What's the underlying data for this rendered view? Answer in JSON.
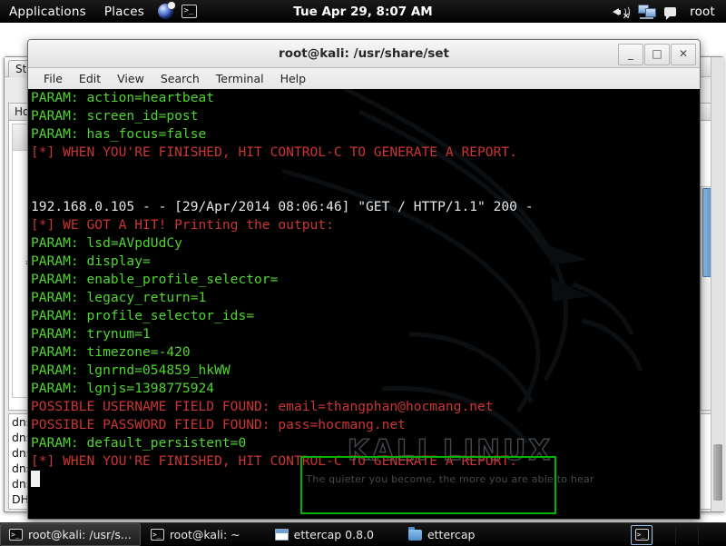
{
  "top_panel": {
    "applications_label": "Applications",
    "places_label": "Places",
    "clock": "Tue Apr 29, 8:07 AM",
    "user_label": "root",
    "launchers": [
      {
        "name": "iceweasel-browser-icon"
      },
      {
        "name": "terminal-icon"
      }
    ],
    "tray": [
      {
        "name": "volume-muted-icon"
      },
      {
        "name": "network-icon"
      },
      {
        "name": "chat-icon"
      }
    ]
  },
  "background_window": {
    "tab_label": "Sta",
    "column_header": "Ho:",
    "star_marker": "*",
    "rows": [
      "dns_",
      "dns_",
      "dns_",
      "dns_",
      "dns_",
      "DHC"
    ]
  },
  "terminal": {
    "title": "root@kali: /usr/share/set",
    "menu": [
      "File",
      "Edit",
      "View",
      "Search",
      "Terminal",
      "Help"
    ],
    "window_buttons": [
      {
        "name": "minimize-button",
        "glyph": "_"
      },
      {
        "name": "maximize-button",
        "glyph": "□"
      },
      {
        "name": "close-button",
        "glyph": "✕"
      }
    ],
    "watermark": {
      "logo": "KALI LINUX",
      "tagline": "The quieter you become, the more you are able to hear"
    },
    "colors": {
      "green": "#4fd430",
      "red": "#cb3434",
      "white": "#e6e6e6",
      "annotation": "#00b200",
      "background": "#000000"
    },
    "lines": [
      {
        "text": "PARAM: action=heartbeat",
        "color": "green"
      },
      {
        "text": "PARAM: screen_id=post",
        "color": "green"
      },
      {
        "text": "PARAM: has_focus=false",
        "color": "green"
      },
      {
        "text": "[*] WHEN YOU'RE FINISHED, HIT CONTROL-C TO GENERATE A REPORT.",
        "color": "red"
      },
      {
        "text": "",
        "color": "blank"
      },
      {
        "text": "",
        "color": "blank"
      },
      {
        "text": "192.168.0.105 - - [29/Apr/2014 08:06:46] \"GET / HTTP/1.1\" 200 -",
        "color": "white"
      },
      {
        "text": "[*] WE GOT A HIT! Printing the output:",
        "color": "red"
      },
      {
        "text": "PARAM: lsd=AVpdUdCy",
        "color": "green"
      },
      {
        "text": "PARAM: display=",
        "color": "green"
      },
      {
        "text": "PARAM: enable_profile_selector=",
        "color": "green"
      },
      {
        "text": "PARAM: legacy_return=1",
        "color": "green"
      },
      {
        "text": "PARAM: profile_selector_ids=",
        "color": "green"
      },
      {
        "text": "PARAM: trynum=1",
        "color": "green"
      },
      {
        "text": "PARAM: timezone=-420",
        "color": "green"
      },
      {
        "text": "PARAM: lgnrnd=054859_hkWW",
        "color": "green"
      },
      {
        "text": "PARAM: lgnjs=1398775924",
        "color": "green"
      },
      {
        "text": "POSSIBLE USERNAME FIELD FOUND: email=thangphan@hocmang.net",
        "color": "red"
      },
      {
        "text": "POSSIBLE PASSWORD FIELD FOUND: pass=hocmang.net",
        "color": "red"
      },
      {
        "text": "PARAM: default_persistent=0",
        "color": "green"
      },
      {
        "text": "[*] WHEN YOU'RE FINISHED, HIT CONTROL-C TO GENERATE A REPORT.",
        "color": "red"
      }
    ]
  },
  "taskbar": {
    "buttons": [
      {
        "label": "root@kali: /usr/s...",
        "icon": "terminal-icon",
        "active": true
      },
      {
        "label": "root@kali: ~",
        "icon": "terminal-icon",
        "active": false
      },
      {
        "label": "ettercap 0.8.0",
        "icon": "window-icon",
        "active": false
      },
      {
        "label": "ettercap",
        "icon": "folder-icon",
        "active": false
      }
    ],
    "tray_icon": "terminal-icon"
  }
}
